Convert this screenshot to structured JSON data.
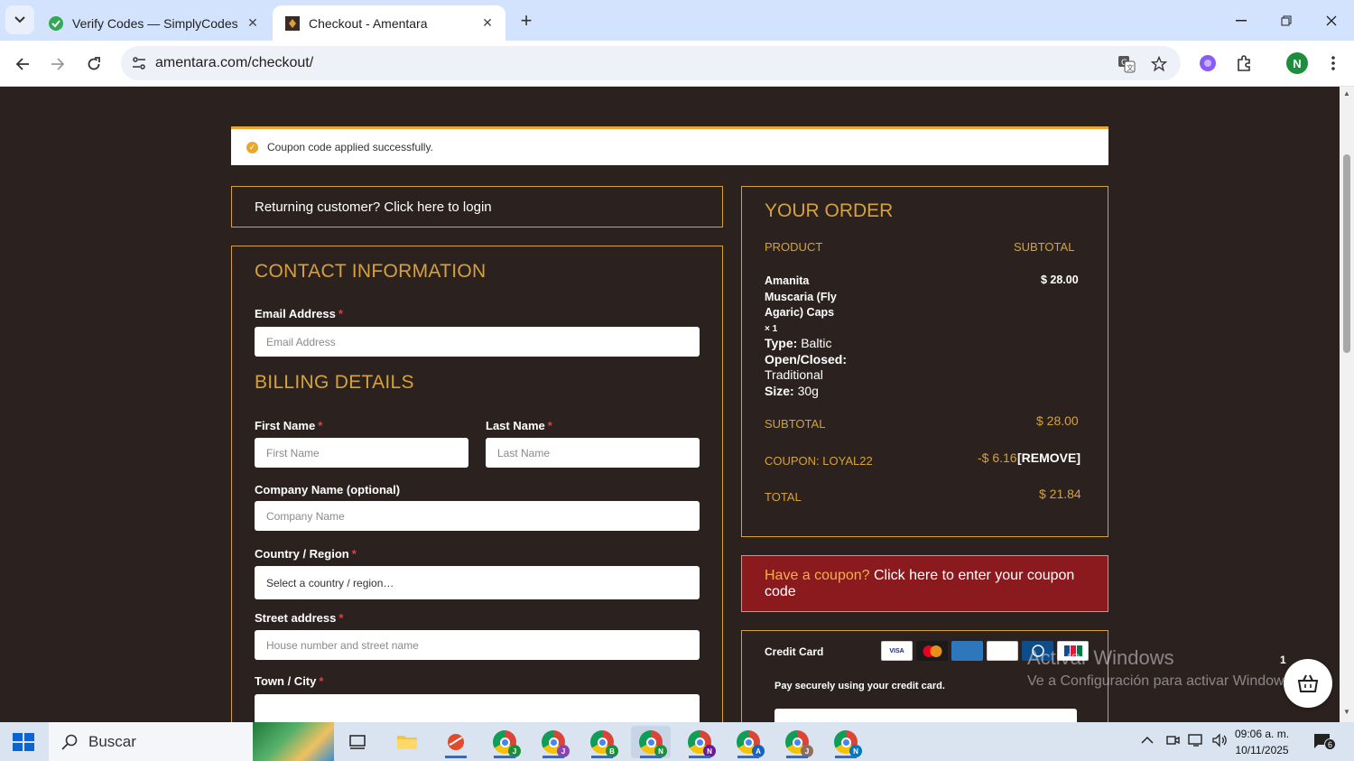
{
  "browser": {
    "tabs": [
      {
        "title": "Verify Codes — SimplyCodes"
      },
      {
        "title": "Checkout - Amentara"
      }
    ],
    "url": "amentara.com/checkout/",
    "profile_initial": "N"
  },
  "notice": {
    "text": "Coupon code applied successfully."
  },
  "login": {
    "text": "Returning customer? Click here to login"
  },
  "contact": {
    "title": "CONTACT INFORMATION",
    "email_label": "Email Address",
    "email_placeholder": "Email Address"
  },
  "billing": {
    "title": "BILLING DETAILS",
    "first_name_label": "First Name",
    "first_name_placeholder": "First Name",
    "last_name_label": "Last Name",
    "last_name_placeholder": "Last Name",
    "company_label": "Company Name (optional)",
    "company_placeholder": "Company Name",
    "country_label": "Country / Region",
    "country_value": "Select a country / region…",
    "street_label": "Street address",
    "street_placeholder": "House number and street name",
    "city_label": "Town / City",
    "required_mark": "*"
  },
  "order": {
    "title": "YOUR ORDER",
    "col_product": "PRODUCT",
    "col_subtotal": "SUBTOTAL",
    "item_name_1": "Amanita",
    "item_name_2": "Muscaria (Fly",
    "item_name_3": "Agaric) Caps",
    "item_qty": "× 1",
    "item_price": "$ 28.00",
    "attr_type_key": "Type:",
    "attr_type_val": "Baltic",
    "attr_open_key": "Open/Closed:",
    "attr_open_val": "Traditional",
    "attr_size_key": "Size:",
    "attr_size_val": "30g",
    "subtotal_label": "SUBTOTAL",
    "subtotal_value": "$ 28.00",
    "coupon_label": "COUPON: LOYAL22",
    "coupon_value": "-$ 6.16",
    "coupon_remove": "[REMOVE]",
    "total_label": "TOTAL",
    "total_value": "$ 21.84"
  },
  "coupon_prompt": {
    "question": "Have a coupon?",
    "link": "Click here to enter your coupon code"
  },
  "payment": {
    "method": "Credit Card",
    "description": "Pay securely using your credit card.",
    "cards": [
      "VISA",
      "MC",
      "AMEX",
      "DISCOVER",
      "DINERS",
      "JCB"
    ]
  },
  "watermark": {
    "line1": "Activar Windows",
    "line2": "Ve a Configuración para activar Windows."
  },
  "cart": {
    "count": "1"
  },
  "taskbar": {
    "search_text": "Buscar",
    "apps": [
      "J",
      "J",
      "B",
      "N",
      "N",
      "A",
      "J",
      "N"
    ],
    "time": "09:06 a. m.",
    "date": "10/11/2025",
    "notifications": "6"
  },
  "colors": {
    "accent": "#d6a13a",
    "page_bg": "#2b2220",
    "coupon_bg": "#8b1a1f",
    "notice_border": "#e8a82e"
  }
}
